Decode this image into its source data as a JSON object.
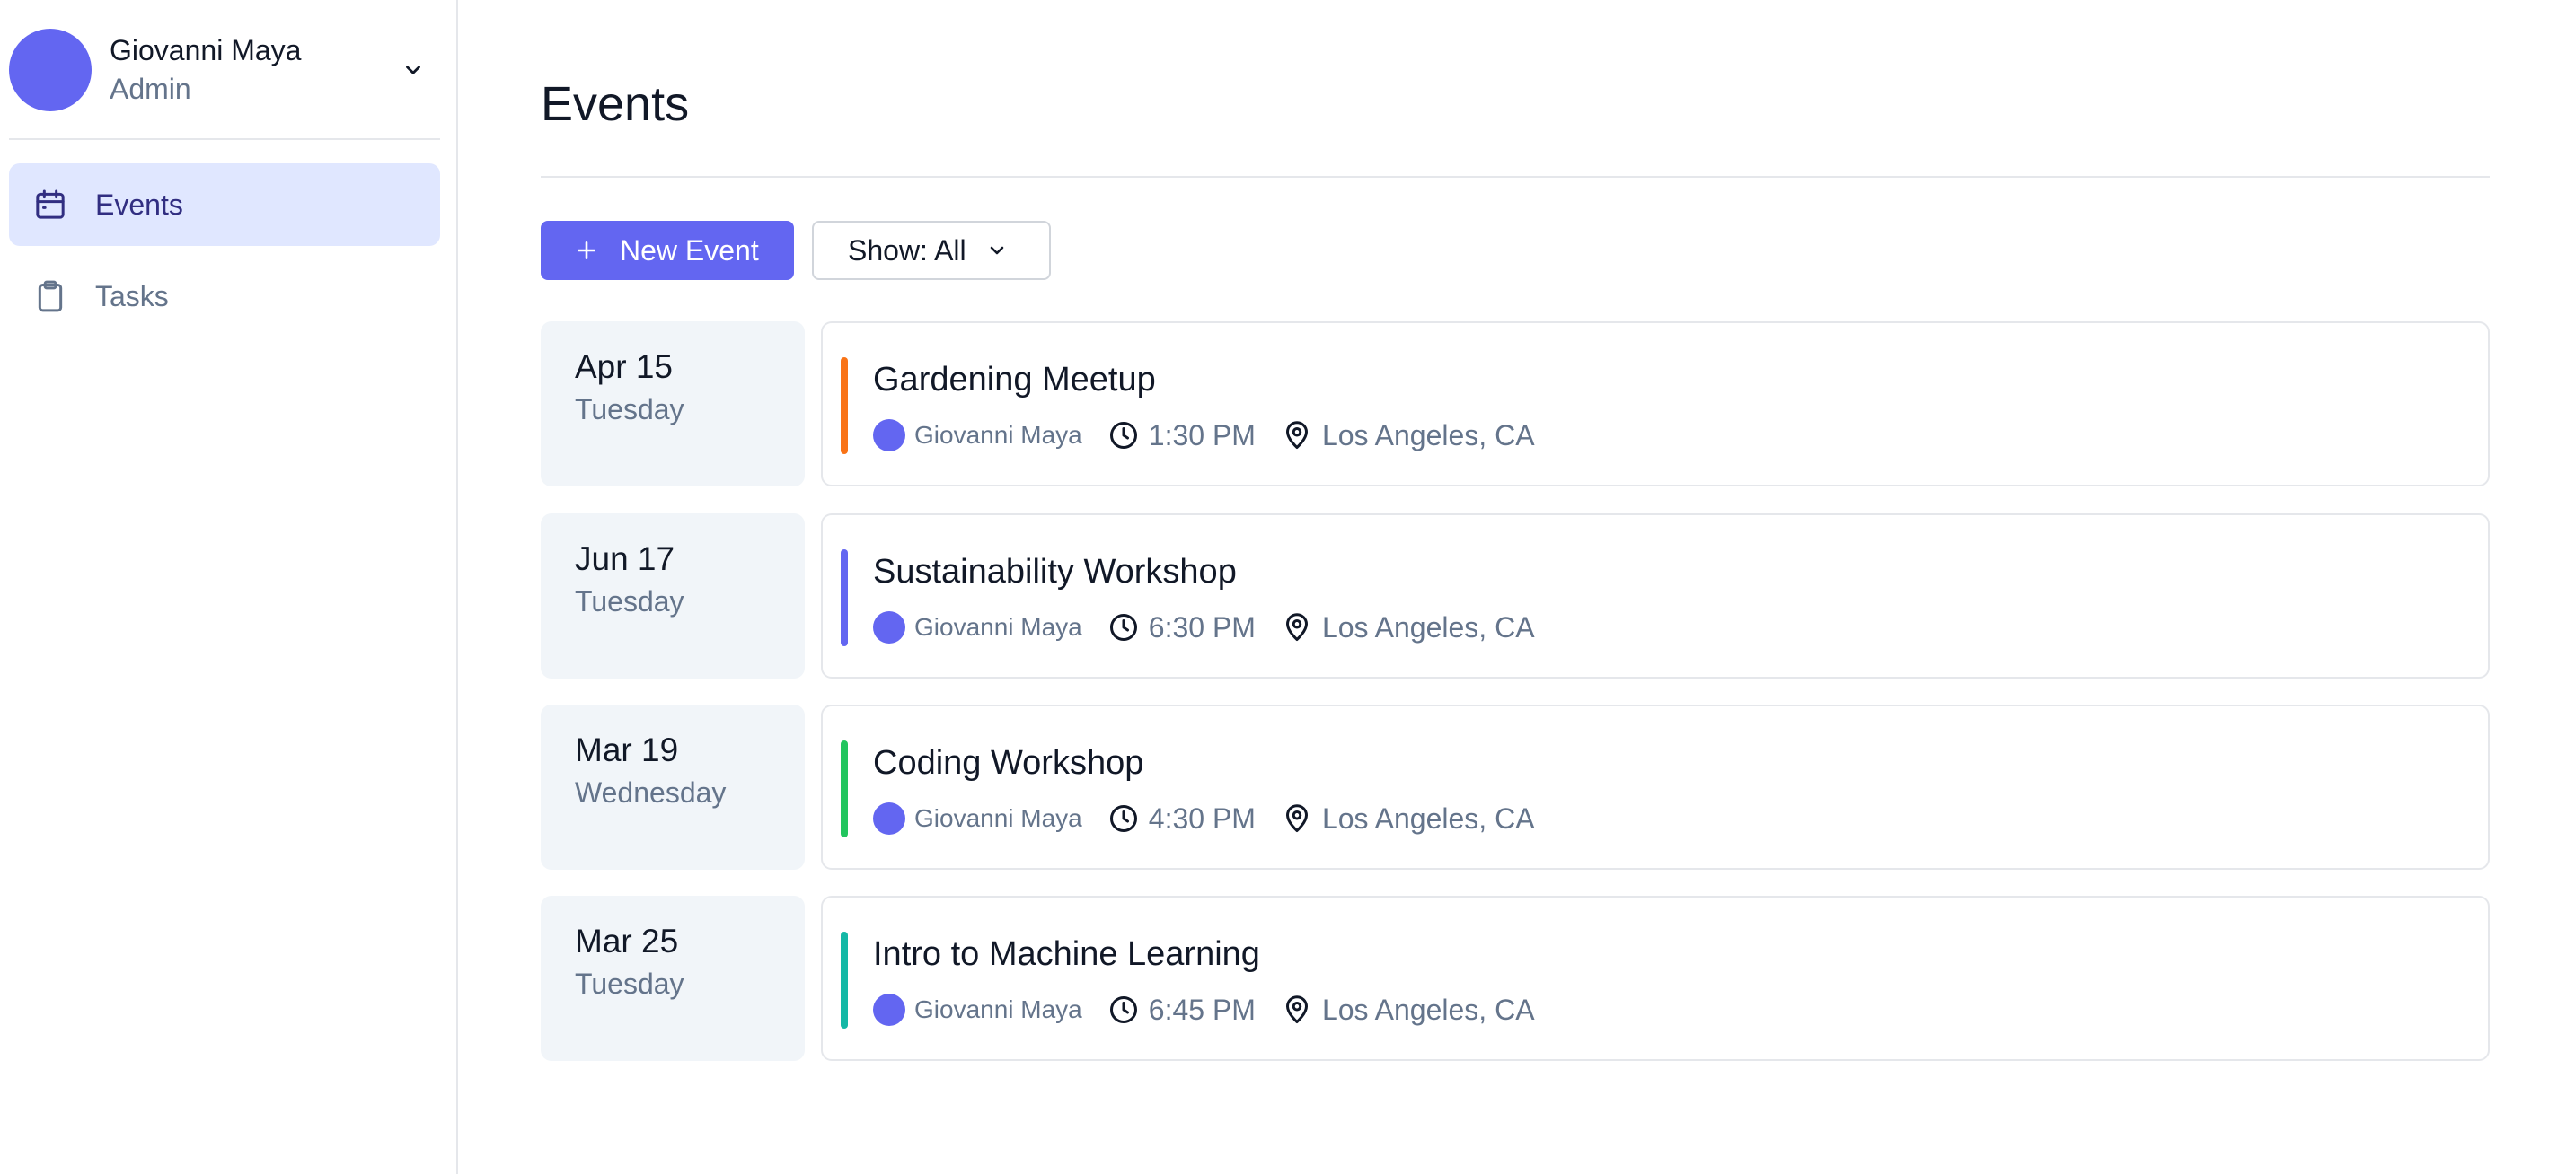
{
  "user": {
    "name": "Giovanni Maya",
    "role": "Admin"
  },
  "sidebar": {
    "items": [
      {
        "label": "Events",
        "icon": "calendar-icon",
        "active": true
      },
      {
        "label": "Tasks",
        "icon": "clipboard-icon",
        "active": false
      }
    ]
  },
  "page": {
    "title": "Events"
  },
  "toolbar": {
    "new_event_label": "New Event",
    "filter_label": "Show: All"
  },
  "colors": {
    "accent": "#6366f1",
    "event_bars": [
      "#f97316",
      "#6366f1",
      "#22c55e",
      "#14b8a6"
    ]
  },
  "events": [
    {
      "date": "Apr 15",
      "weekday": "Tuesday",
      "title": "Gardening Meetup",
      "organizer": "Giovanni Maya",
      "time": "1:30 PM",
      "location": "Los Angeles, CA"
    },
    {
      "date": "Jun 17",
      "weekday": "Tuesday",
      "title": "Sustainability Workshop",
      "organizer": "Giovanni Maya",
      "time": "6:30 PM",
      "location": "Los Angeles, CA"
    },
    {
      "date": "Mar 19",
      "weekday": "Wednesday",
      "title": "Coding Workshop",
      "organizer": "Giovanni Maya",
      "time": "4:30 PM",
      "location": "Los Angeles, CA"
    },
    {
      "date": "Mar 25",
      "weekday": "Tuesday",
      "title": "Intro to Machine Learning",
      "organizer": "Giovanni Maya",
      "time": "6:45 PM",
      "location": "Los Angeles, CA"
    }
  ]
}
